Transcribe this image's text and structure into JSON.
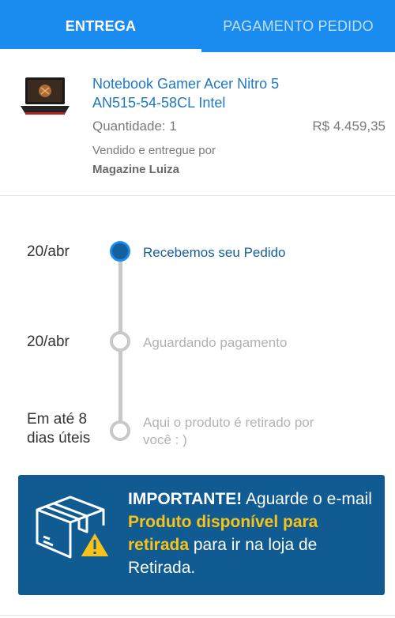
{
  "tabs": {
    "entrega": "ENTREGA",
    "pagamento": "PAGAMENTO PEDIDO"
  },
  "product": {
    "name_line1": "Notebook Gamer Acer Nitro 5",
    "name_line2": "AN515-54-58CL Intel",
    "quantity": "Quantidade: 1",
    "price": "R$ 4.459,35",
    "sold_by": "Vendido e entregue por",
    "seller": "Magazine Luiza"
  },
  "timeline": [
    {
      "date": "20/abr",
      "label": "Recebemos seu Pedido",
      "status": "done"
    },
    {
      "date": "20/abr",
      "label": "Aguardando pagamento",
      "status": "pending"
    },
    {
      "date_line1": "Em até 8",
      "date_line2": "dias úteis",
      "label_line1": "Aqui o produto é retirado por",
      "label_line2": "você : )",
      "status": "pending"
    }
  ],
  "notice": {
    "important": "IMPORTANTE!",
    "part1": " Aguarde o e-mail ",
    "highlight": "Produto disponível para retirada",
    "part2": " para ir na loja de Retirada."
  },
  "colors": {
    "header": "#1a8cf0",
    "link": "#1f78c1",
    "active_step": "#155f9c",
    "notice_bg": "#115b93",
    "highlight": "#f7c318"
  },
  "icons": [
    "laptop-thumbnail",
    "package-warning-icon"
  ]
}
